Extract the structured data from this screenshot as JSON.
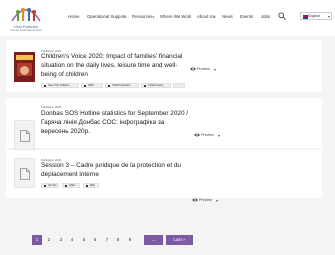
{
  "header": {
    "logo_text": "Child Protection",
    "logo_sub": "Hub for South East Europe",
    "nav": [
      "Home",
      "Operational Support",
      "Resources",
      "Where We Work",
      "About Us",
      "News",
      "Events",
      "Jobs"
    ],
    "language": "English"
  },
  "results": [
    {
      "published": "Published: 2020",
      "title": "Children's Voice 2020: Impact of families' financial situation on the daily lives, leisure time and well-being of children",
      "tags": [
        "Save The Children",
        "2020",
        "Child Protection",
        "Child Poverty",
        "..."
      ],
      "preview_label": "Preview"
    },
    {
      "published": "Published: 2020",
      "title": "Donbas SOS Hotline statistics for September 2020 / Гаряча лінія Донбас СОС: інфографіка за вересень 2020р.",
      "tags": [
        "UK info",
        "2020",
        "UA news"
      ],
      "preview_label": "Preview"
    },
    {
      "published": "Published: 2020",
      "title": "Session 3 – Cadre juridique de la protection et du déplacement interne",
      "tags": [
        "UK info",
        "2020",
        "Mali"
      ],
      "preview_label": "Preview"
    }
  ],
  "pagination": {
    "pages": [
      "1",
      "2",
      "3",
      "4",
      "5",
      "6",
      "7",
      "8",
      "9"
    ],
    "active": "1",
    "next_label": "→",
    "last_label": "Last »"
  },
  "colors": {
    "accent": "#7b5aa6"
  }
}
